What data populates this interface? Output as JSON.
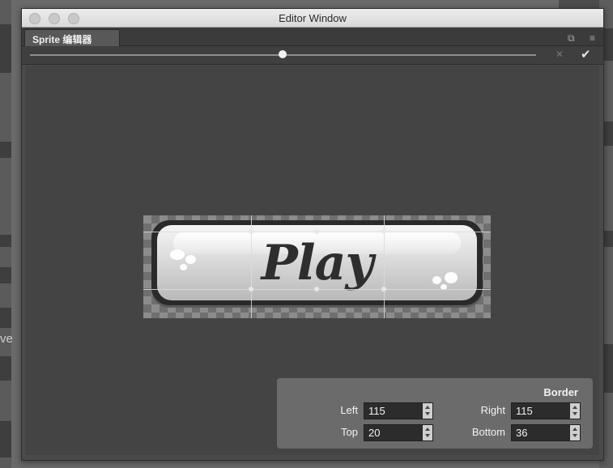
{
  "window": {
    "title": "Editor Window"
  },
  "tab": {
    "label": "Sprite 编辑器"
  },
  "toolbar": {
    "check_icon": "check-icon",
    "close_icon": "close-icon"
  },
  "sprite_preview": {
    "button_text": "Play"
  },
  "border_panel": {
    "title": "Border",
    "fields": [
      {
        "label": "Left",
        "value": "115"
      },
      {
        "label": "Right",
        "value": "115"
      },
      {
        "label": "Top",
        "value": "20"
      },
      {
        "label": "Bottom",
        "value": "36"
      }
    ]
  },
  "background": {
    "left_fragment": "ve"
  }
}
